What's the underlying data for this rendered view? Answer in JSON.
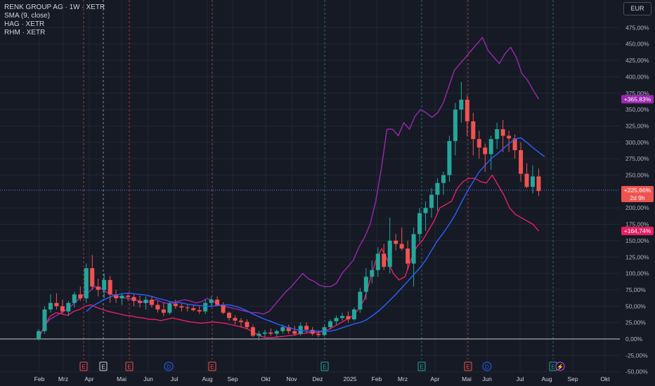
{
  "legend": {
    "title": "RENK GROUP AG · 1W · XETR",
    "sma": "SMA (9, close)",
    "series2": "HAG · XETR",
    "series3": "RHM · XETR"
  },
  "currency_button": "EUR",
  "colors": {
    "background": "#161a25",
    "grid": "#232734",
    "up": "#26a69a",
    "down": "#ef5350",
    "sma": "#2962ff",
    "hag": "#9c27b0",
    "rhm": "#e91e63",
    "text": "#b2b5be"
  },
  "chart_data": {
    "type": "candlestick",
    "y_unit": "%",
    "ylim": [
      -50,
      490
    ],
    "y_ticks": [
      "475,00%",
      "450,00%",
      "425,00%",
      "400,00%",
      "375,00%",
      "350,00%",
      "325,00%",
      "300,00%",
      "275,00%",
      "250,00%",
      "200,00%",
      "175,00%",
      "150,00%",
      "125,00%",
      "100,00%",
      "75,00%",
      "50,00%",
      "25,00%",
      "0,00%",
      "-25,00%",
      "-50,00%"
    ],
    "x_ticks": [
      "Feb",
      "Mrz",
      "Apr",
      "Mai",
      "Jun",
      "Jul",
      "Aug",
      "Sep",
      "Okt",
      "Nov",
      "Dez",
      "2025",
      "Feb",
      "Mrz",
      "Apr",
      "Mai",
      "Jun",
      "Jul",
      "Aug",
      "Sep",
      "Okt"
    ],
    "candles": [
      {
        "o": 0,
        "h": 15,
        "l": -2,
        "c": 12
      },
      {
        "o": 12,
        "h": 50,
        "l": 8,
        "c": 45
      },
      {
        "o": 45,
        "h": 68,
        "l": 40,
        "c": 55
      },
      {
        "o": 55,
        "h": 70,
        "l": 45,
        "c": 50
      },
      {
        "o": 50,
        "h": 60,
        "l": 38,
        "c": 42
      },
      {
        "o": 42,
        "h": 58,
        "l": 35,
        "c": 55
      },
      {
        "o": 55,
        "h": 72,
        "l": 48,
        "c": 68
      },
      {
        "o": 68,
        "h": 80,
        "l": 58,
        "c": 62
      },
      {
        "o": 62,
        "h": 115,
        "l": 55,
        "c": 108
      },
      {
        "o": 108,
        "h": 128,
        "l": 75,
        "c": 80
      },
      {
        "o": 80,
        "h": 92,
        "l": 65,
        "c": 75
      },
      {
        "o": 75,
        "h": 100,
        "l": 62,
        "c": 90
      },
      {
        "o": 90,
        "h": 96,
        "l": 55,
        "c": 68
      },
      {
        "o": 68,
        "h": 75,
        "l": 55,
        "c": 62
      },
      {
        "o": 62,
        "h": 70,
        "l": 52,
        "c": 66
      },
      {
        "o": 66,
        "h": 70,
        "l": 58,
        "c": 64
      },
      {
        "o": 64,
        "h": 68,
        "l": 50,
        "c": 58
      },
      {
        "o": 58,
        "h": 66,
        "l": 48,
        "c": 55
      },
      {
        "o": 55,
        "h": 65,
        "l": 45,
        "c": 60
      },
      {
        "o": 60,
        "h": 65,
        "l": 48,
        "c": 52
      },
      {
        "o": 52,
        "h": 58,
        "l": 40,
        "c": 45
      },
      {
        "o": 45,
        "h": 55,
        "l": 35,
        "c": 40
      },
      {
        "o": 40,
        "h": 58,
        "l": 37,
        "c": 54
      },
      {
        "o": 54,
        "h": 60,
        "l": 46,
        "c": 50
      },
      {
        "o": 50,
        "h": 54,
        "l": 42,
        "c": 48
      },
      {
        "o": 48,
        "h": 52,
        "l": 42,
        "c": 47
      },
      {
        "o": 47,
        "h": 52,
        "l": 42,
        "c": 44
      },
      {
        "o": 44,
        "h": 50,
        "l": 38,
        "c": 42
      },
      {
        "o": 42,
        "h": 60,
        "l": 38,
        "c": 55
      },
      {
        "o": 55,
        "h": 65,
        "l": 48,
        "c": 60
      },
      {
        "o": 60,
        "h": 65,
        "l": 50,
        "c": 52
      },
      {
        "o": 52,
        "h": 56,
        "l": 38,
        "c": 40
      },
      {
        "o": 40,
        "h": 42,
        "l": 28,
        "c": 32
      },
      {
        "o": 32,
        "h": 36,
        "l": 22,
        "c": 28
      },
      {
        "o": 28,
        "h": 32,
        "l": 18,
        "c": 26
      },
      {
        "o": 26,
        "h": 30,
        "l": 15,
        "c": 18
      },
      {
        "o": 18,
        "h": 22,
        "l": 3,
        "c": 5
      },
      {
        "o": 5,
        "h": 12,
        "l": -2,
        "c": 8
      },
      {
        "o": 8,
        "h": 14,
        "l": 3,
        "c": 10
      },
      {
        "o": 10,
        "h": 16,
        "l": 5,
        "c": 8
      },
      {
        "o": 8,
        "h": 14,
        "l": 2,
        "c": 12
      },
      {
        "o": 12,
        "h": 22,
        "l": 8,
        "c": 18
      },
      {
        "o": 18,
        "h": 22,
        "l": 8,
        "c": 12
      },
      {
        "o": 12,
        "h": 20,
        "l": 5,
        "c": 8
      },
      {
        "o": 8,
        "h": 25,
        "l": 5,
        "c": 20
      },
      {
        "o": 20,
        "h": 25,
        "l": 10,
        "c": 14
      },
      {
        "o": 14,
        "h": 18,
        "l": 5,
        "c": 8
      },
      {
        "o": 8,
        "h": 12,
        "l": 3,
        "c": 6
      },
      {
        "o": 6,
        "h": 22,
        "l": 4,
        "c": 18
      },
      {
        "o": 18,
        "h": 30,
        "l": 15,
        "c": 27
      },
      {
        "o": 27,
        "h": 36,
        "l": 22,
        "c": 32
      },
      {
        "o": 32,
        "h": 40,
        "l": 28,
        "c": 35
      },
      {
        "o": 35,
        "h": 42,
        "l": 25,
        "c": 30
      },
      {
        "o": 30,
        "h": 48,
        "l": 28,
        "c": 45
      },
      {
        "o": 45,
        "h": 78,
        "l": 40,
        "c": 72
      },
      {
        "o": 72,
        "h": 108,
        "l": 60,
        "c": 95
      },
      {
        "o": 95,
        "h": 120,
        "l": 85,
        "c": 105
      },
      {
        "o": 105,
        "h": 140,
        "l": 95,
        "c": 130
      },
      {
        "o": 130,
        "h": 145,
        "l": 105,
        "c": 110
      },
      {
        "o": 110,
        "h": 185,
        "l": 100,
        "c": 150
      },
      {
        "o": 150,
        "h": 160,
        "l": 135,
        "c": 145
      },
      {
        "o": 145,
        "h": 170,
        "l": 135,
        "c": 138
      },
      {
        "o": 138,
        "h": 150,
        "l": 105,
        "c": 115
      },
      {
        "o": 115,
        "h": 170,
        "l": 80,
        "c": 160
      },
      {
        "o": 160,
        "h": 200,
        "l": 148,
        "c": 192
      },
      {
        "o": 192,
        "h": 210,
        "l": 165,
        "c": 200
      },
      {
        "o": 200,
        "h": 230,
        "l": 185,
        "c": 220
      },
      {
        "o": 220,
        "h": 245,
        "l": 195,
        "c": 238
      },
      {
        "o": 238,
        "h": 255,
        "l": 220,
        "c": 250
      },
      {
        "o": 250,
        "h": 310,
        "l": 240,
        "c": 302
      },
      {
        "o": 302,
        "h": 360,
        "l": 280,
        "c": 350
      },
      {
        "o": 350,
        "h": 392,
        "l": 330,
        "c": 365
      },
      {
        "o": 365,
        "h": 372,
        "l": 310,
        "c": 332
      },
      {
        "o": 332,
        "h": 345,
        "l": 280,
        "c": 305
      },
      {
        "o": 305,
        "h": 318,
        "l": 275,
        "c": 292
      },
      {
        "o": 292,
        "h": 298,
        "l": 255,
        "c": 282
      },
      {
        "o": 282,
        "h": 310,
        "l": 258,
        "c": 305
      },
      {
        "o": 305,
        "h": 330,
        "l": 290,
        "c": 320
      },
      {
        "o": 320,
        "h": 334,
        "l": 285,
        "c": 310
      },
      {
        "o": 310,
        "h": 318,
        "l": 285,
        "c": 306
      },
      {
        "o": 306,
        "h": 312,
        "l": 275,
        "c": 288
      },
      {
        "o": 288,
        "h": 300,
        "l": 240,
        "c": 252
      },
      {
        "o": 252,
        "h": 268,
        "l": 230,
        "c": 232
      },
      {
        "o": 232,
        "h": 265,
        "l": 222,
        "c": 248
      },
      {
        "o": 248,
        "h": 260,
        "l": 218,
        "c": 225.66
      }
    ],
    "sma": [
      null,
      null,
      null,
      null,
      null,
      null,
      null,
      null,
      42,
      50,
      55,
      60,
      64,
      67,
      69,
      70,
      69,
      68,
      67,
      65,
      62,
      60,
      57,
      56,
      55,
      53,
      52,
      51,
      50,
      50,
      51,
      52,
      52,
      50,
      47,
      43,
      38,
      34,
      30,
      27,
      23,
      20,
      17,
      15,
      13,
      12,
      12,
      12,
      12,
      12,
      14,
      17,
      20,
      23,
      25,
      29,
      35,
      42,
      50,
      59,
      68,
      78,
      88,
      98,
      108,
      120,
      135,
      150,
      162,
      175,
      190,
      208,
      225,
      240,
      255,
      265,
      275,
      282,
      290,
      298,
      305,
      307,
      300,
      292,
      285,
      278
    ],
    "hag": [
      0,
      20,
      30,
      35,
      40,
      45,
      52,
      60,
      68,
      72,
      80,
      78,
      72,
      68,
      65,
      63,
      62,
      60,
      58,
      55,
      58,
      60,
      56,
      54,
      55,
      58,
      60,
      58,
      55,
      57,
      62,
      58,
      52,
      50,
      48,
      46,
      44,
      42,
      40,
      40,
      38,
      42,
      52,
      62,
      72,
      80,
      90,
      100,
      92,
      88,
      82,
      80,
      80,
      85,
      100,
      110,
      120,
      140,
      155,
      175,
      210,
      260,
      320,
      320,
      310,
      330,
      320,
      340,
      350,
      345,
      338,
      345,
      360,
      385,
      410,
      420,
      430,
      440,
      450,
      460,
      440,
      430,
      420,
      435,
      445,
      430,
      405,
      395,
      380,
      365.83
    ],
    "rhm": [
      0,
      20,
      35,
      40,
      38,
      36,
      42,
      45,
      50,
      52,
      48,
      45,
      42,
      40,
      38,
      36,
      35,
      33,
      32,
      30,
      30,
      28,
      30,
      32,
      30,
      28,
      26,
      25,
      24,
      25,
      26,
      25,
      24,
      22,
      20,
      18,
      15,
      10,
      5,
      2,
      2,
      3,
      4,
      5,
      6,
      8,
      9,
      10,
      10,
      12,
      15,
      20,
      25,
      30,
      35,
      45,
      60,
      90,
      120,
      138,
      120,
      100,
      90,
      95,
      120,
      140,
      150,
      165,
      180,
      200,
      205,
      210,
      230,
      240,
      245,
      245,
      240,
      238,
      250,
      235,
      220,
      200,
      190,
      185,
      180,
      175,
      164.74
    ],
    "last_labels": {
      "hag": "+365,83%",
      "renk": "+225,66%",
      "renk_countdown": "2d 9h",
      "rhm": "+164,74%"
    },
    "events": [
      {
        "label": "E",
        "kind": "earnings-red"
      },
      {
        "label": "E",
        "kind": "earnings-white"
      },
      {
        "label": "E",
        "kind": "earnings-red"
      },
      {
        "label": "D",
        "kind": "dividend"
      },
      {
        "label": "E",
        "kind": "earnings-red"
      },
      {
        "label": "E",
        "kind": "earnings-green"
      },
      {
        "label": "E",
        "kind": "earnings-green"
      },
      {
        "label": "E",
        "kind": "earnings-red"
      },
      {
        "label": "D",
        "kind": "dividend"
      },
      {
        "label": "E",
        "kind": "earnings-green"
      },
      {
        "label": "⚡",
        "kind": "split"
      }
    ]
  }
}
